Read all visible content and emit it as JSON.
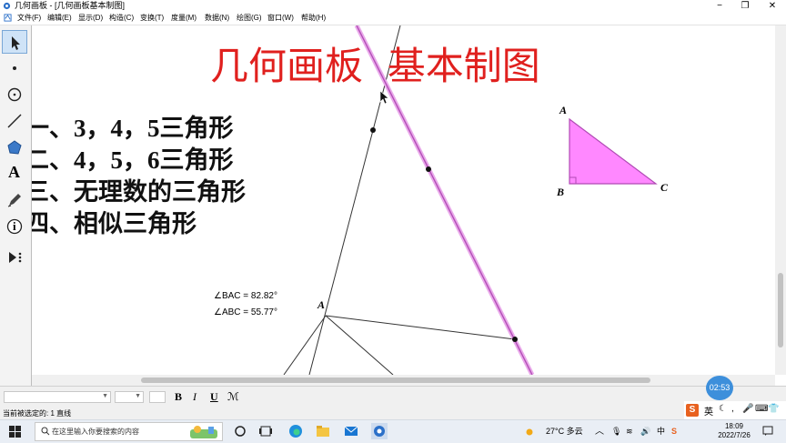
{
  "window": {
    "title": "几何画板 - [几何画板基本制图]",
    "controls": [
      "−",
      "❐",
      "✕"
    ]
  },
  "menu": [
    "文件(F)",
    "编辑(E)",
    "显示(D)",
    "构造(C)",
    "变换(T)",
    "度量(M)",
    "数据(N)",
    "绘图(G)",
    "窗口(W)",
    "帮助(H)"
  ],
  "toolbox": {
    "tools": [
      "arrow-select-tool",
      "point-tool",
      "compass-tool",
      "straightedge-tool",
      "polygon-tool",
      "text-tool",
      "marker-tool",
      "information-tool",
      "custom-tools"
    ],
    "text_tool_glyph": "A",
    "info_glyph": "i"
  },
  "canvas": {
    "heading": "几何画板  基本制图",
    "list": [
      "一、3，4，5三角形",
      "二、4，5，6三角形",
      "三、无理数的三角形",
      "四、相似三角形"
    ],
    "triangle_labels": {
      "A": "A",
      "B": "B",
      "C": "C"
    },
    "measure1": "∠BAC = 82.82°",
    "measure2": "∠ABC = 55.77°",
    "point_label_A": "A",
    "fill_color": "#ff88ff",
    "accent_red": "#e0201e",
    "line_color": "#d46ad4"
  },
  "text_toolbar": {
    "bold": "B",
    "italic": "I",
    "underline": "U",
    "special": "ℳ"
  },
  "status": "当前被选定的: 1 直线",
  "timer": "02:53",
  "ime": {
    "label": "英"
  },
  "taskbar": {
    "search_placeholder": "在这里输入你要搜索的内容",
    "weather": "27°C  多云",
    "time": "18:09",
    "date": "2022/7/26",
    "lang": "中"
  }
}
